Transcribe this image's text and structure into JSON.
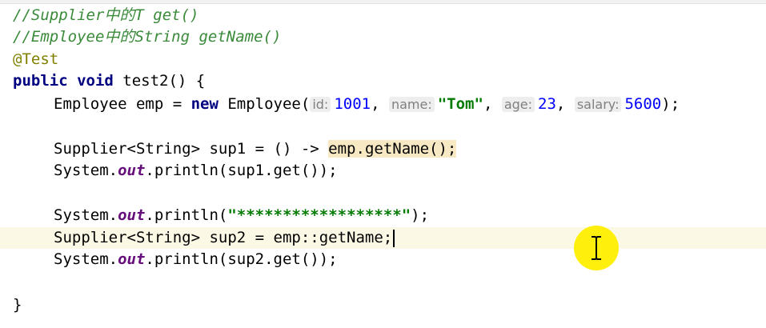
{
  "editor": {
    "lines": {
      "l1": "//Supplier中的T get()",
      "l2": "//Employee中的String getName()",
      "l3": "@Test",
      "l4": {
        "kw_public": "public",
        "kw_void": "void",
        "rest": " test2() {"
      },
      "l5": {
        "pre": "Employee emp = ",
        "kw_new": "new",
        "call": " Employee(",
        "hint_id": "id:",
        "val_id": "1001",
        "sep1": ", ",
        "hint_name": "name:",
        "val_name": "\"Tom\"",
        "sep2": ", ",
        "hint_age": "age:",
        "val_age": "23",
        "sep3": ", ",
        "hint_salary": "salary:",
        "val_salary": "5600",
        "end": ");"
      },
      "l6": {
        "pre": "Supplier<String> sup1 = () -> ",
        "highlight": "emp",
        "rest": ".getName();"
      },
      "l7": {
        "pre": "System.",
        "out": "out",
        "rest": ".println(sup1.get());"
      },
      "l8": {
        "pre": "System.",
        "out": "out",
        "mid": ".println(",
        "str": "\"******************\"",
        "end": ");"
      },
      "l9": "Supplier<String> sup2 = emp::getName;",
      "l10": {
        "pre": "System.",
        "out": "out",
        "rest": ".println(sup2.get());"
      },
      "l11": "}"
    },
    "colors": {
      "comment": "#3a8a3a",
      "keyword": "#000080",
      "string": "#007a00",
      "number": "#0000ff",
      "static_field": "#660e7a",
      "annotation": "#808000",
      "current_line": "#fcf8e6",
      "cursor_highlight": "#ffee00"
    },
    "cursor_icon": "i-beam-icon"
  }
}
